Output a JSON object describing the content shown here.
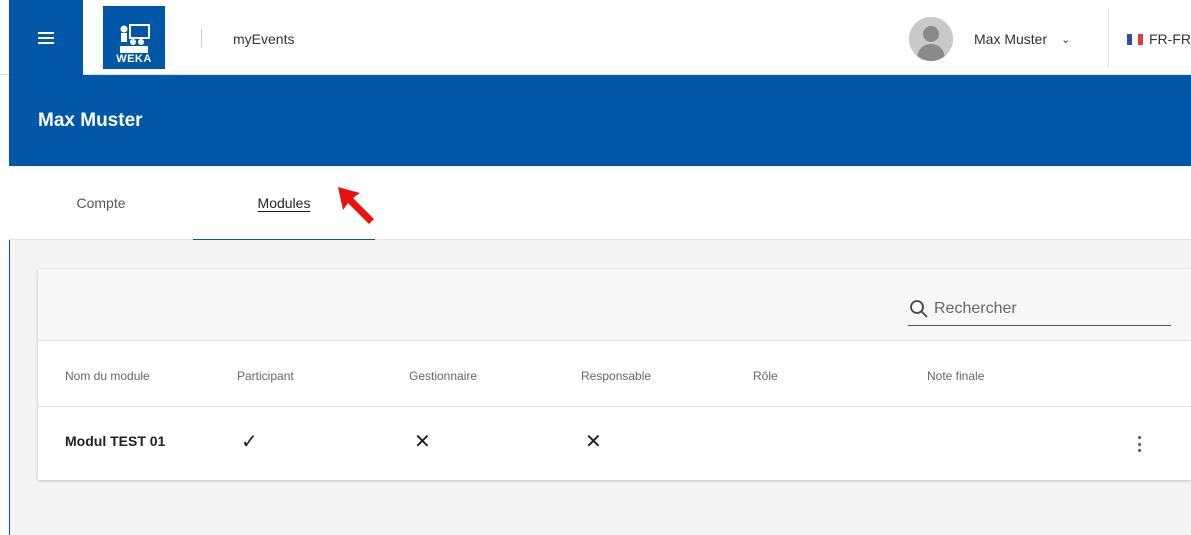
{
  "app": {
    "logo_text": "WEKA",
    "title": "myEvents",
    "user_name": "Max Muster",
    "user_chevron": "⌄",
    "language": "FR-FR",
    "brand_color": "#0057a8"
  },
  "header": {
    "title": "Max Muster"
  },
  "tabs": [
    {
      "label": "Compte",
      "active": false
    },
    {
      "label": "Modules",
      "active": true
    }
  ],
  "search": {
    "placeholder": "Rechercher",
    "value": ""
  },
  "table": {
    "columns": [
      "Nom du module",
      "Participant",
      "Gestionnaire",
      "Responsable",
      "Rôle",
      "Note finale"
    ],
    "rows": [
      {
        "name": "Modul TEST 01",
        "participant": "✓",
        "gestionnaire": "✕",
        "responsable": "✕",
        "role": "",
        "note_finale": ""
      }
    ]
  },
  "icons": {
    "menu": "hamburger-icon",
    "avatar": "user-avatar-icon",
    "flag": "france-flag-icon",
    "search": "search-icon",
    "row_menu": "more-vertical-icon",
    "annotation": "red-arrow-icon"
  }
}
